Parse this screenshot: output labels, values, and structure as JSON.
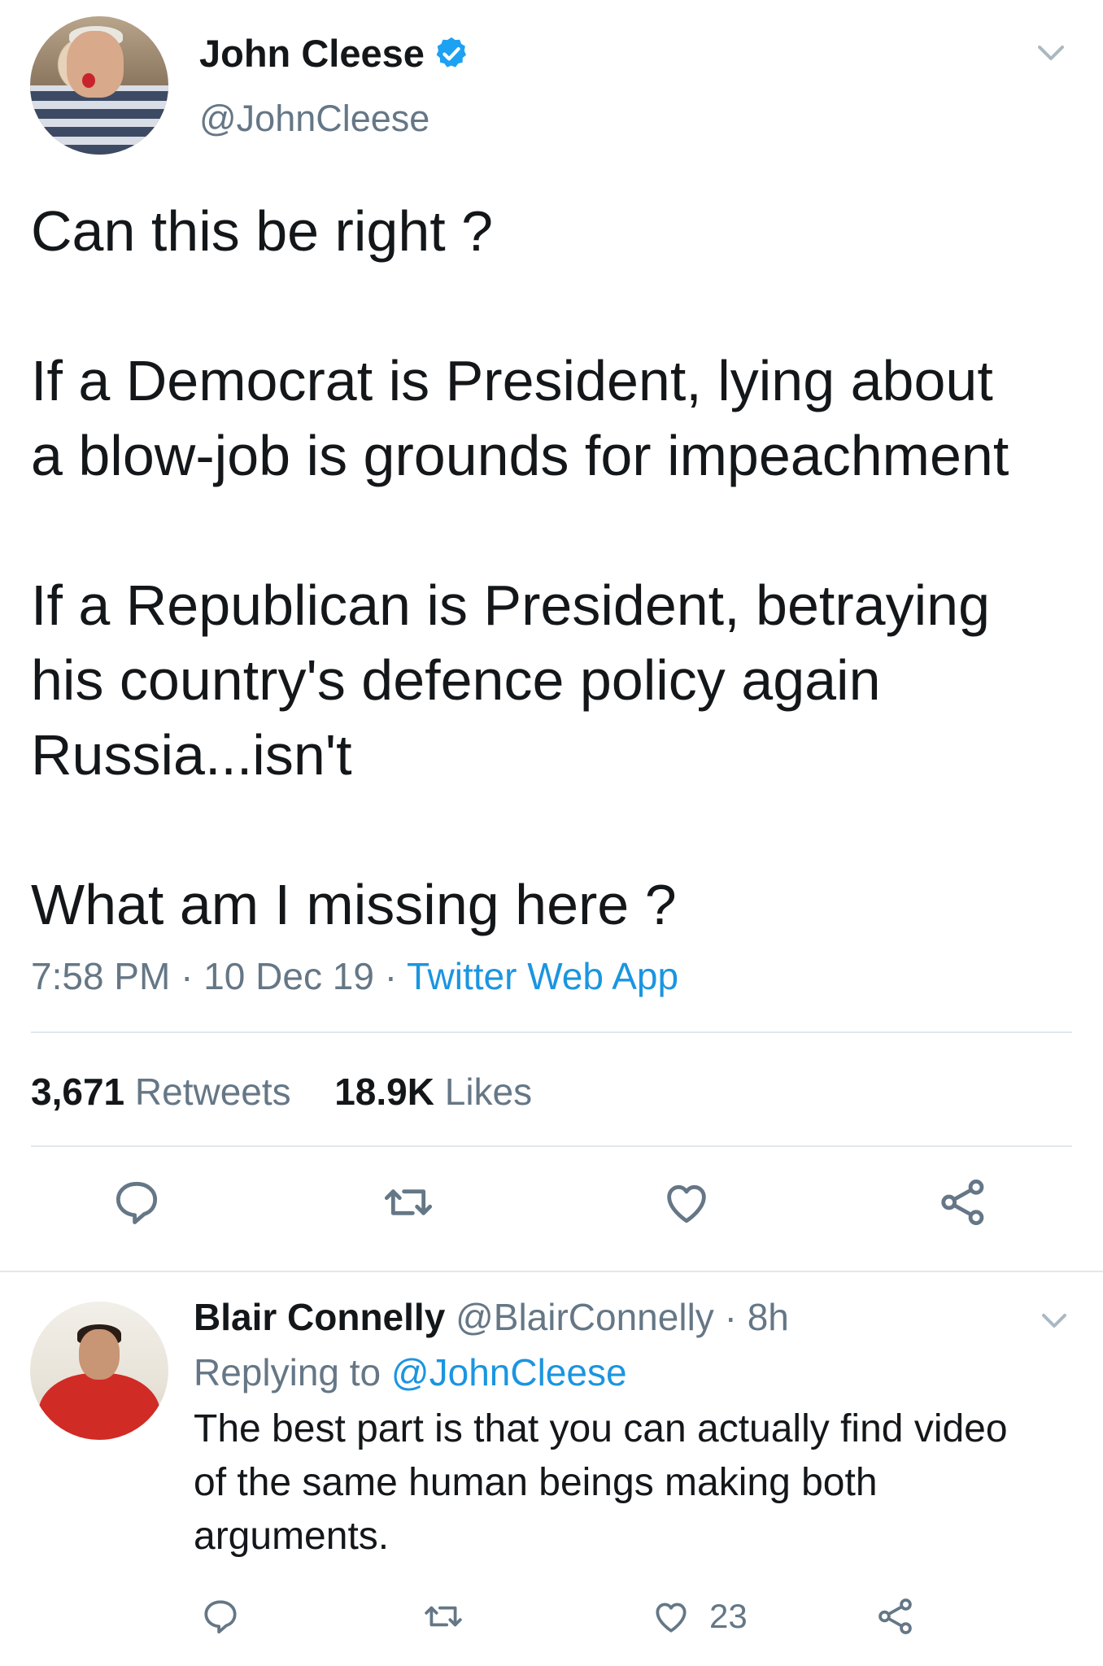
{
  "tweet": {
    "author_name": "John Cleese",
    "handle": "@JohnCleese",
    "text_lines": [
      "Can this be right ?",
      "If a Democrat is President, lying about",
      "a blow-job is grounds for impeachment",
      "If a Republican is President, betraying",
      "his country's defence policy again",
      "Russia...isn't",
      "What am I missing here ?"
    ],
    "time": "7:58 PM",
    "date": "10 Dec 19",
    "source": "Twitter Web App",
    "retweet_count": "3,671",
    "retweet_label": "Retweets",
    "like_count": "18.9K",
    "like_label": "Likes",
    "icons": [
      "verified-badge-icon",
      "chevron-down-icon",
      "reply-icon",
      "retweet-icon",
      "like-icon",
      "share-icon"
    ]
  },
  "reply": {
    "author_name": "Blair Connelly",
    "handle": "@BlairConnelly",
    "age": "8h",
    "replying_label": "Replying to",
    "replying_to": "@JohnCleese",
    "text_lines": [
      "The best part is that you can actually find video",
      "of the same human beings making both",
      "arguments."
    ],
    "like_count": "23"
  },
  "colors": {
    "text": "#14171a",
    "secondary": "#657786",
    "link": "#1b95e0",
    "divider": "#e1e8ed"
  }
}
